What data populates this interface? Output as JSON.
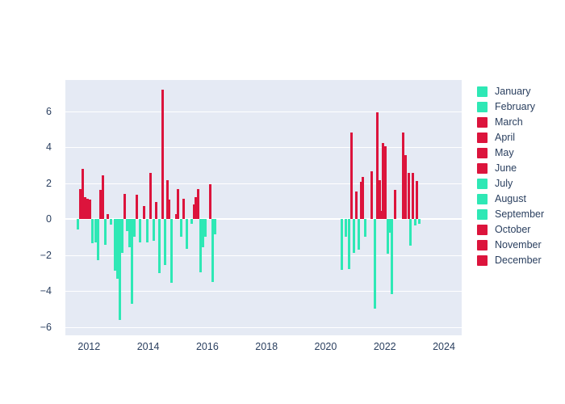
{
  "chart_data": {
    "type": "bar",
    "title": "",
    "subtitle": "",
    "xlabel": "",
    "ylabel": "",
    "xlim": [
      2011.2,
      2024.6
    ],
    "ylim": [
      -6.45,
      7.75
    ],
    "grid": true,
    "gridlines_y": [
      6,
      4,
      2,
      0,
      -2,
      -4,
      -6
    ],
    "xticks": [
      2012,
      2014,
      2016,
      2018,
      2020,
      2022,
      2024
    ],
    "yticks": [
      6,
      4,
      2,
      0,
      -2,
      -4,
      -6
    ],
    "legend_position": "right",
    "colors": {
      "positive": "#DC143C",
      "negative": "#2EE8B5",
      "plot_background": "#E5EAF4",
      "paper_background": "#FFFFFF",
      "gridline": "#FFFFFF",
      "tick_text": "#2A3F5F"
    },
    "legend": [
      {
        "label": "January",
        "color": "#2EE8B5"
      },
      {
        "label": "February",
        "color": "#2EE8B5"
      },
      {
        "label": "March",
        "color": "#DC143C"
      },
      {
        "label": "April",
        "color": "#DC143C"
      },
      {
        "label": "May",
        "color": "#DC143C"
      },
      {
        "label": "June",
        "color": "#DC143C"
      },
      {
        "label": "July",
        "color": "#2EE8B5"
      },
      {
        "label": "August",
        "color": "#2EE8B5"
      },
      {
        "label": "September",
        "color": "#2EE8B5"
      },
      {
        "label": "October",
        "color": "#DC143C"
      },
      {
        "label": "November",
        "color": "#DC143C"
      },
      {
        "label": "December",
        "color": "#DC143C"
      }
    ],
    "points": [
      {
        "x": 2011.62,
        "y": -0.55
      },
      {
        "x": 2011.7,
        "y": 1.7
      },
      {
        "x": 2011.78,
        "y": 2.8
      },
      {
        "x": 2011.86,
        "y": 1.25
      },
      {
        "x": 2011.94,
        "y": 1.15
      },
      {
        "x": 2012.02,
        "y": 1.1
      },
      {
        "x": 2012.12,
        "y": -1.35
      },
      {
        "x": 2012.22,
        "y": -1.3
      },
      {
        "x": 2012.3,
        "y": -2.25
      },
      {
        "x": 2012.4,
        "y": 1.65
      },
      {
        "x": 2012.48,
        "y": 2.45
      },
      {
        "x": 2012.56,
        "y": -1.4
      },
      {
        "x": 2012.64,
        "y": 0.3
      },
      {
        "x": 2012.74,
        "y": -0.3
      },
      {
        "x": 2012.88,
        "y": -2.85
      },
      {
        "x": 2012.96,
        "y": -3.3
      },
      {
        "x": 2013.04,
        "y": -5.6
      },
      {
        "x": 2013.12,
        "y": -1.85
      },
      {
        "x": 2013.2,
        "y": 1.4
      },
      {
        "x": 2013.28,
        "y": -0.65
      },
      {
        "x": 2013.36,
        "y": -1.55
      },
      {
        "x": 2013.44,
        "y": -4.7
      },
      {
        "x": 2013.54,
        "y": -0.95
      },
      {
        "x": 2013.62,
        "y": 1.35
      },
      {
        "x": 2013.72,
        "y": -1.3
      },
      {
        "x": 2013.86,
        "y": 0.75
      },
      {
        "x": 2013.96,
        "y": -1.3
      },
      {
        "x": 2014.08,
        "y": 2.6
      },
      {
        "x": 2014.18,
        "y": -1.2
      },
      {
        "x": 2014.28,
        "y": 0.95
      },
      {
        "x": 2014.38,
        "y": -3.0
      },
      {
        "x": 2014.48,
        "y": 7.2
      },
      {
        "x": 2014.56,
        "y": -2.55
      },
      {
        "x": 2014.64,
        "y": 2.2
      },
      {
        "x": 2014.72,
        "y": 1.1
      },
      {
        "x": 2014.8,
        "y": -3.55
      },
      {
        "x": 2014.94,
        "y": 0.3
      },
      {
        "x": 2015.02,
        "y": 1.7
      },
      {
        "x": 2015.12,
        "y": -0.95
      },
      {
        "x": 2015.2,
        "y": 1.15
      },
      {
        "x": 2015.3,
        "y": -1.65
      },
      {
        "x": 2015.46,
        "y": -0.25
      },
      {
        "x": 2015.56,
        "y": 0.85
      },
      {
        "x": 2015.62,
        "y": 1.25
      },
      {
        "x": 2015.68,
        "y": 1.7
      },
      {
        "x": 2015.76,
        "y": -2.95
      },
      {
        "x": 2015.86,
        "y": -1.55
      },
      {
        "x": 2015.94,
        "y": -0.95
      },
      {
        "x": 2016.1,
        "y": 1.95
      },
      {
        "x": 2016.18,
        "y": -3.5
      },
      {
        "x": 2016.26,
        "y": -0.85
      },
      {
        "x": 2020.56,
        "y": -2.8
      },
      {
        "x": 2020.68,
        "y": -0.95
      },
      {
        "x": 2020.78,
        "y": -2.75
      },
      {
        "x": 2020.88,
        "y": 4.85
      },
      {
        "x": 2020.96,
        "y": -1.85
      },
      {
        "x": 2021.04,
        "y": 1.55
      },
      {
        "x": 2021.12,
        "y": -1.7
      },
      {
        "x": 2021.2,
        "y": 2.1
      },
      {
        "x": 2021.26,
        "y": 2.35
      },
      {
        "x": 2021.34,
        "y": -0.95
      },
      {
        "x": 2021.56,
        "y": 2.65
      },
      {
        "x": 2021.66,
        "y": -4.95
      },
      {
        "x": 2021.76,
        "y": 5.95
      },
      {
        "x": 2021.82,
        "y": 2.2
      },
      {
        "x": 2021.88,
        "y": 0.45
      },
      {
        "x": 2021.94,
        "y": 4.25
      },
      {
        "x": 2022.02,
        "y": 4.05
      },
      {
        "x": 2022.1,
        "y": -1.9
      },
      {
        "x": 2022.18,
        "y": -0.75
      },
      {
        "x": 2022.24,
        "y": -4.15
      },
      {
        "x": 2022.34,
        "y": 1.65
      },
      {
        "x": 2022.62,
        "y": 4.85
      },
      {
        "x": 2022.7,
        "y": 3.55
      },
      {
        "x": 2022.8,
        "y": 2.6
      },
      {
        "x": 2022.86,
        "y": -1.45
      },
      {
        "x": 2022.94,
        "y": 2.6
      },
      {
        "x": 2023.02,
        "y": -0.35
      },
      {
        "x": 2023.08,
        "y": 2.15
      },
      {
        "x": 2023.16,
        "y": -0.25
      }
    ]
  }
}
